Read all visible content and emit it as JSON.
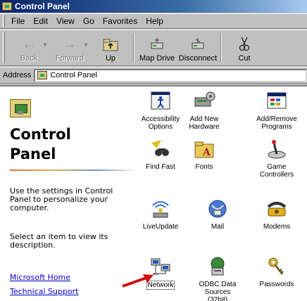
{
  "window": {
    "title": "Control Panel"
  },
  "menu": {
    "items": [
      "File",
      "Edit",
      "View",
      "Go",
      "Favorites",
      "Help"
    ]
  },
  "toolbar": {
    "buttons": [
      {
        "label": "Back",
        "icon": "back-arrow-icon",
        "enabled": false
      },
      {
        "label": "Forward",
        "icon": "forward-arrow-icon",
        "enabled": false
      },
      {
        "label": "Up",
        "icon": "up-folder-icon",
        "enabled": true
      },
      {
        "label": "Map Drive",
        "icon": "map-drive-icon",
        "enabled": true
      },
      {
        "label": "Disconnect",
        "icon": "disconnect-drive-icon",
        "enabled": true
      },
      {
        "label": "Cut",
        "icon": "scissors-icon",
        "enabled": true
      }
    ]
  },
  "address": {
    "label": "Address",
    "value": "Control Panel"
  },
  "left_pane": {
    "title_line1": "Control",
    "title_line2": "Panel",
    "description1": "Use the settings in Control Panel to personalize your computer.",
    "description2": "Select an item to view its description.",
    "links": [
      "Microsoft Home",
      "Technical Support"
    ]
  },
  "icons": [
    {
      "label": "Accessibility Options",
      "icon": "accessibility-icon"
    },
    {
      "label": "Add New Hardware",
      "icon": "add-hardware-icon"
    },
    {
      "label": "Add/Remove Programs",
      "icon": "add-remove-programs-icon"
    },
    {
      "label": "Find Fast",
      "icon": "find-fast-icon"
    },
    {
      "label": "Fonts",
      "icon": "fonts-folder-icon"
    },
    {
      "label": "Game Controllers",
      "icon": "joystick-icon"
    },
    {
      "label": "LiveUpdate",
      "icon": "liveupdate-icon"
    },
    {
      "label": "Mail",
      "icon": "mail-icon"
    },
    {
      "label": "Modems",
      "icon": "modem-telephone-icon"
    },
    {
      "label": "Network",
      "icon": "network-computers-icon",
      "selected": true
    },
    {
      "label": "ODBC Data Sources (32bit)",
      "icon": "odbc-icon"
    },
    {
      "label": "Passwords",
      "icon": "keys-icon"
    }
  ],
  "colors": {
    "titlebar_start": "#0a246a",
    "titlebar_end": "#a6caf0",
    "link": "#0000cc",
    "annotation_arrow": "#d01010"
  }
}
